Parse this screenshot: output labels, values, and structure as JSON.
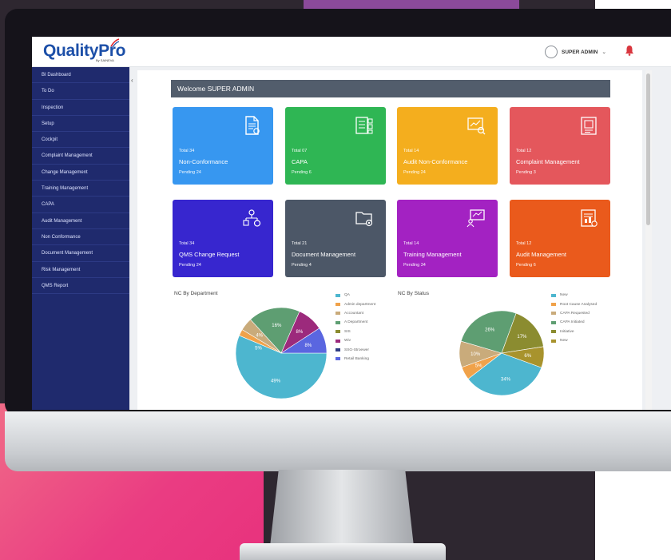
{
  "app": {
    "brand": "QualityPro",
    "brand_sub": "By SAINEVA",
    "user_name": "SUPER ADMIN",
    "caret": "⌄"
  },
  "sidebar": {
    "collapse_icon": "‹",
    "items": [
      "BI Dashboard",
      "To Do",
      "Inspection",
      "Setup",
      "Cockpit",
      "Complaint Management",
      "Change Management",
      "Training Management",
      "CAPA",
      "Audit Management",
      "Non Conformance",
      "Document Management",
      "Risk Management",
      "QMS Report"
    ]
  },
  "welcome": "Welcome SUPER ADMIN",
  "cards": [
    {
      "total": "Total 34",
      "title": "Non-Conformance",
      "pending": "Pending 24",
      "color": "#3797f0",
      "icon": "document-icon"
    },
    {
      "total": "Total 07",
      "title": "CAPA",
      "pending": "Pending 6",
      "color": "#2fb654",
      "icon": "checklist-icon"
    },
    {
      "total": "Total 14",
      "title": "Audit Non-Conformance",
      "pending": "Pending 24",
      "color": "#f4ae1e",
      "icon": "audit-icon"
    },
    {
      "total": "Total 12",
      "title": "Complaint Management",
      "pending": "Pending 3",
      "color": "#e4575c",
      "icon": "clipboard-icon"
    },
    {
      "total": "Total 34",
      "title": "QMS Change Request",
      "pending": "Pending 24",
      "color": "#3726cf",
      "icon": "org-chart-icon"
    },
    {
      "total": "Total 21",
      "title": "Document Management",
      "pending": "Pending 4",
      "color": "#4c5767",
      "icon": "folder-gear-icon"
    },
    {
      "total": "Total 14",
      "title": "Training Management",
      "pending": "Pending 34",
      "color": "#a322c2",
      "icon": "presentation-icon"
    },
    {
      "total": "Total 12",
      "title": "Audit Management",
      "pending": "Pending 6",
      "color": "#ea5a1c",
      "icon": "report-icon"
    }
  ],
  "chart_data": [
    {
      "type": "pie",
      "title": "NC By Department",
      "labels": [
        "QA",
        "Admin department",
        "Accountant",
        "A Department",
        "SIS",
        "Wiv",
        "SSG-Stroewer",
        "Retail Banking"
      ],
      "colors": [
        "#4db6cf",
        "#f0a24a",
        "#c9ab7b",
        "#5e9e72",
        "#8b8c30",
        "#9c2a7c",
        "#2f3c82",
        "#5a66e0"
      ],
      "values": [
        49,
        2,
        4,
        16,
        0,
        8,
        0,
        8
      ],
      "value_labels": [
        "49%",
        "",
        "4%",
        "16%",
        "",
        "8%",
        "",
        "8%"
      ],
      "extra_labels": [
        "5%"
      ]
    },
    {
      "type": "pie",
      "title": "NC By Status",
      "labels": [
        "New",
        "Root Cause Analysed",
        "CAPA Requested",
        "CAPA Initiated",
        "Initiative",
        "New"
      ],
      "colors": [
        "#4db6cf",
        "#f0a24a",
        "#c9ab7b",
        "#5e9e72",
        "#8b8c30",
        "#a8932d"
      ],
      "values": [
        34,
        5,
        10,
        26,
        17,
        8
      ],
      "value_labels": [
        "34%",
        "5%",
        "10%",
        "26%",
        "17%",
        "6%"
      ]
    }
  ]
}
